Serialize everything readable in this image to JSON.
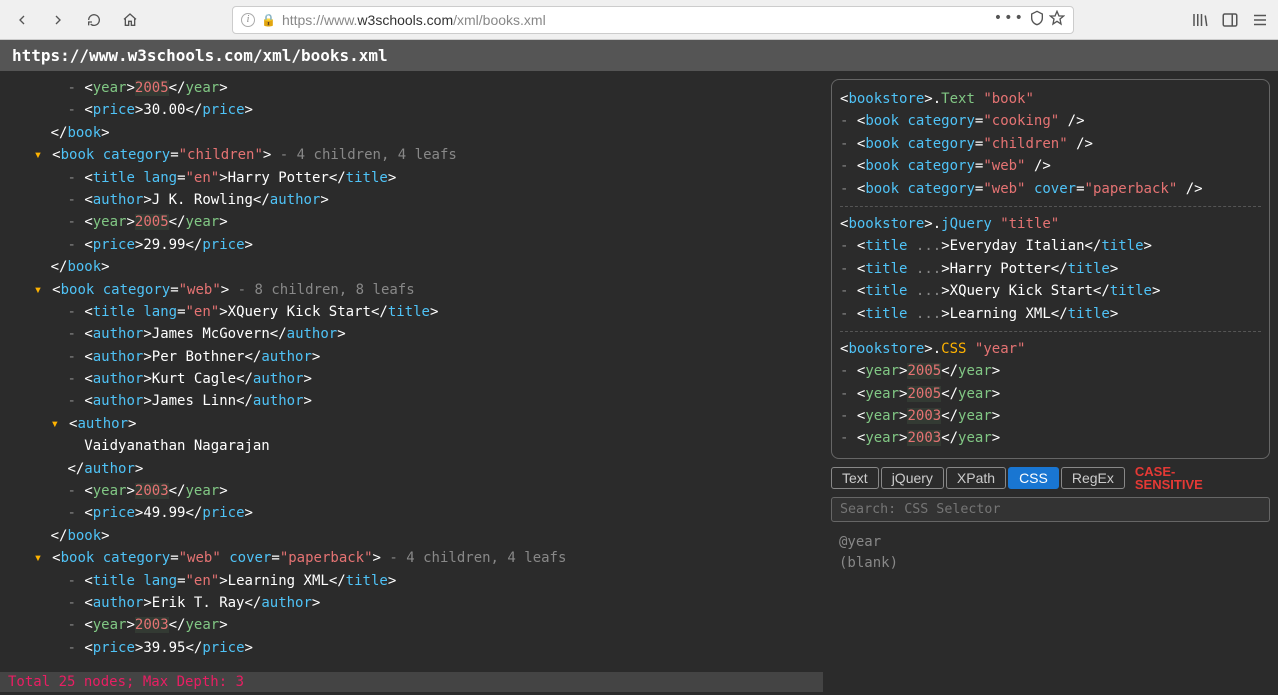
{
  "browser": {
    "url_display_dim1": "https://www.",
    "url_display_bold": "w3schools.com",
    "url_display_dim2": "/xml/books.xml",
    "title_bar": "https://www.w3schools.com/xml/books.xml"
  },
  "status": "Total 25 nodes; Max Depth: 3",
  "xml_lines": [
    {
      "i": 4,
      "t": "prop",
      "tag": "year",
      "txt": "2005",
      "yr": true
    },
    {
      "i": 4,
      "t": "prop",
      "tag": "price",
      "txt": "30.00"
    },
    {
      "i": 3,
      "t": "close",
      "tag": "book"
    },
    {
      "i": 3,
      "t": "open",
      "tag": "book",
      "attrs": [
        {
          "k": "category",
          "v": "children"
        }
      ],
      "meta": "4 children, 4 leafs"
    },
    {
      "i": 4,
      "t": "prop",
      "tag": "title",
      "attrs": [
        {
          "k": "lang",
          "v": "en"
        }
      ],
      "txt": "Harry Potter"
    },
    {
      "i": 4,
      "t": "prop",
      "tag": "author",
      "txt": "J K. Rowling"
    },
    {
      "i": 4,
      "t": "prop",
      "tag": "year",
      "txt": "2005",
      "yr": true
    },
    {
      "i": 4,
      "t": "prop",
      "tag": "price",
      "txt": "29.99"
    },
    {
      "i": 3,
      "t": "close",
      "tag": "book"
    },
    {
      "i": 3,
      "t": "open",
      "tag": "book",
      "attrs": [
        {
          "k": "category",
          "v": "web"
        }
      ],
      "meta": "8 children, 8 leafs"
    },
    {
      "i": 4,
      "t": "prop",
      "tag": "title",
      "attrs": [
        {
          "k": "lang",
          "v": "en"
        }
      ],
      "txt": "XQuery Kick Start"
    },
    {
      "i": 4,
      "t": "prop",
      "tag": "author",
      "txt": "James McGovern"
    },
    {
      "i": 4,
      "t": "prop",
      "tag": "author",
      "txt": "Per Bothner"
    },
    {
      "i": 4,
      "t": "prop",
      "tag": "author",
      "txt": "Kurt Cagle"
    },
    {
      "i": 4,
      "t": "prop",
      "tag": "author",
      "txt": "James Linn"
    },
    {
      "i": 4,
      "t": "openonly",
      "tag": "author"
    },
    {
      "i": 5,
      "t": "text",
      "txt": "Vaidyanathan Nagarajan"
    },
    {
      "i": 4,
      "t": "closeonly",
      "tag": "author"
    },
    {
      "i": 4,
      "t": "prop",
      "tag": "year",
      "txt": "2003",
      "yr": true
    },
    {
      "i": 4,
      "t": "prop",
      "tag": "price",
      "txt": "49.99"
    },
    {
      "i": 3,
      "t": "close",
      "tag": "book"
    },
    {
      "i": 3,
      "t": "open",
      "tag": "book",
      "attrs": [
        {
          "k": "category",
          "v": "web"
        },
        {
          "k": "cover",
          "v": "paperback"
        }
      ],
      "meta": "4 children, 4 leafs"
    },
    {
      "i": 4,
      "t": "prop",
      "tag": "title",
      "attrs": [
        {
          "k": "lang",
          "v": "en"
        }
      ],
      "txt": "Learning XML"
    },
    {
      "i": 4,
      "t": "prop",
      "tag": "author",
      "txt": "Erik T. Ray"
    },
    {
      "i": 4,
      "t": "prop",
      "tag": "year",
      "txt": "2003",
      "yr": true
    },
    {
      "i": 4,
      "t": "prop",
      "tag": "price",
      "txt": "39.95"
    }
  ],
  "result_groups": [
    {
      "header": {
        "root": "bookstore",
        "method": "Text",
        "methodClass": "m1",
        "q": "book"
      },
      "items": [
        {
          "tag": "book",
          "attrs": [
            {
              "k": "category",
              "v": "cooking"
            }
          ],
          "self": true
        },
        {
          "tag": "book",
          "attrs": [
            {
              "k": "category",
              "v": "children"
            }
          ],
          "self": true
        },
        {
          "tag": "book",
          "attrs": [
            {
              "k": "category",
              "v": "web"
            }
          ],
          "self": true
        },
        {
          "tag": "book",
          "attrs": [
            {
              "k": "category",
              "v": "web"
            },
            {
              "k": "cover",
              "v": "paperback"
            }
          ],
          "self": true
        }
      ]
    },
    {
      "header": {
        "root": "bookstore",
        "method": "jQuery",
        "methodClass": "m2",
        "q": "title"
      },
      "items": [
        {
          "tag": "title",
          "ellipsis": true,
          "txt": "Everyday Italian"
        },
        {
          "tag": "title",
          "ellipsis": true,
          "txt": "Harry Potter"
        },
        {
          "tag": "title",
          "ellipsis": true,
          "txt": "XQuery Kick Start"
        },
        {
          "tag": "title",
          "ellipsis": true,
          "txt": "Learning XML"
        }
      ]
    },
    {
      "header": {
        "root": "bookstore",
        "method": "CSS",
        "methodClass": "m3",
        "q": "year"
      },
      "items": [
        {
          "tag": "year",
          "txt": "2005",
          "yr": true
        },
        {
          "tag": "year",
          "txt": "2005",
          "yr": true
        },
        {
          "tag": "year",
          "txt": "2003",
          "yr": true
        },
        {
          "tag": "year",
          "txt": "2003",
          "yr": true
        }
      ]
    }
  ],
  "tabs": [
    {
      "label": "Text",
      "active": false
    },
    {
      "label": "jQuery",
      "active": false
    },
    {
      "label": "XPath",
      "active": false
    },
    {
      "label": "CSS",
      "active": true
    },
    {
      "label": "RegEx",
      "active": false
    }
  ],
  "case_sensitive": "CASE-SENSITIVE",
  "search_placeholder": "Search: CSS Selector",
  "history": [
    "@year",
    "(blank)"
  ]
}
